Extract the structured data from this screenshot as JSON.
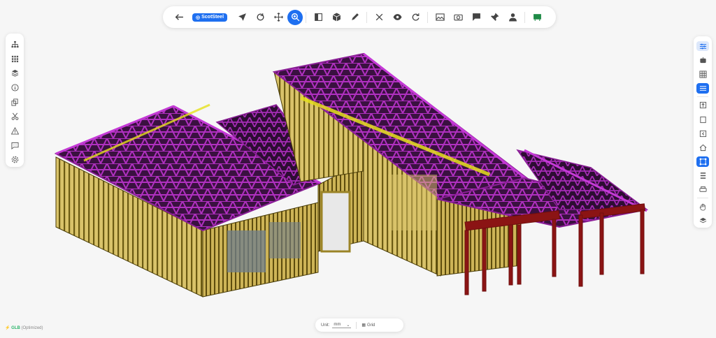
{
  "toolbar": {
    "brand_label": "ScotSteel",
    "tools": [
      {
        "name": "back-icon",
        "glyph": "←"
      },
      {
        "name": "select-pointer-icon"
      },
      {
        "name": "orbit-icon"
      },
      {
        "name": "pan-icon"
      },
      {
        "name": "zoom-icon",
        "active": true
      },
      {
        "name": "section-box-icon"
      },
      {
        "name": "cube-icon"
      },
      {
        "name": "markup-pen-icon"
      },
      {
        "name": "close-x-icon"
      },
      {
        "name": "visibility-eye-icon"
      },
      {
        "name": "reset-rotate-icon"
      },
      {
        "name": "image-icon"
      },
      {
        "name": "camera-icon"
      },
      {
        "name": "comment-icon"
      },
      {
        "name": "pin-icon"
      },
      {
        "name": "person-icon"
      },
      {
        "name": "green-board-icon"
      }
    ]
  },
  "left_sidebar": [
    "hierarchy-icon",
    "grid-icon",
    "layers-icon",
    "info-icon",
    "models-icon",
    "scissors-icon",
    "warning-icon",
    "chat-icon",
    "settings-icon"
  ],
  "right_sidebar": [
    "filters-icon",
    "robot-icon",
    "table-icon",
    "list-icon",
    "export-icon",
    "frame-icon",
    "back-step-icon",
    "home-icon",
    "measure-icon",
    "stack-lines-icon",
    "print-icon",
    "hand-icon",
    "layers-icon"
  ],
  "bottom_bar": {
    "unit_label": "Unit:",
    "unit_value": "mm",
    "grid_label": "Grid"
  },
  "status": {
    "mode": "GLB",
    "note": "(Optimized)"
  },
  "colors": {
    "accent": "#1e6ff0",
    "frame": "#9b8427",
    "truss": "#8a1f96",
    "beam": "#8b1414",
    "purlin": "#d8d21a",
    "window": "#5b6d7e"
  }
}
